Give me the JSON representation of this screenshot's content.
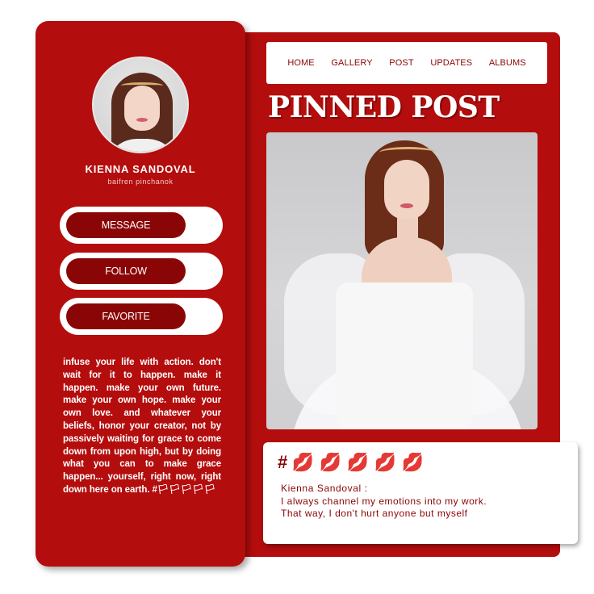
{
  "profile": {
    "name": "KIENNA  SANDOVAL",
    "handle": "baifren  pinchanok"
  },
  "actions": {
    "message": "MESSAGE",
    "follow": "FOLLOW",
    "favorite": "FAVORITE"
  },
  "quote": "infuse your life with action. don't wait for it to happen. make it happen. make your own future. make your own hope. make your own love. and whatever your beliefs, honor your creator, not by passively waiting for grace to come down from upon high, but by doing what you can to make grace happen... yourself, right now, right down here on earth. #🏳🏳🏳🏳🏳",
  "nav": {
    "items": [
      "HOME",
      "GALLERY",
      "POST",
      "UPDATES",
      "ALBUMS"
    ]
  },
  "pinned": {
    "title": "PINNED POST"
  },
  "post": {
    "hash": "#",
    "icons": [
      "💋",
      "💋",
      "💋",
      "💋",
      "💋"
    ],
    "author": "Kienna  Sandoval  :",
    "text": "I  always  channel  my  emotions  into  my  work.  That  way,  I  don't  hurt  anyone  but  myself"
  },
  "colors": {
    "primary": "#b40d0d",
    "dark_red": "#8a0606",
    "white": "#ffffff"
  }
}
